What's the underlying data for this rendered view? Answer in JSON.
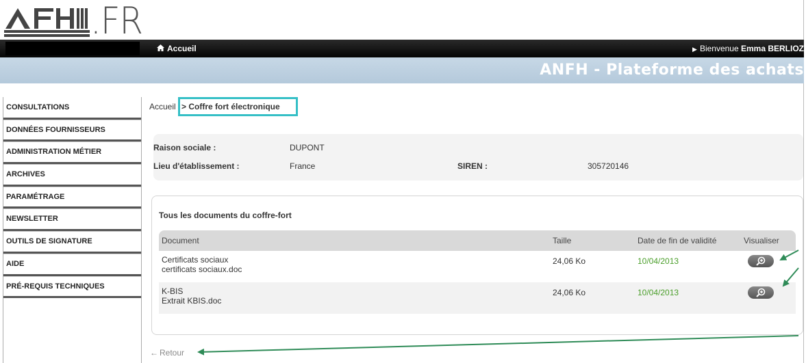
{
  "logo": {
    "brand_text": ".FR",
    "logo_name": "ANFH"
  },
  "topbar": {
    "home_label": "Accueil",
    "welcome_prefix": "Bienvenue ",
    "welcome_user": "Emma BERLIOZ"
  },
  "band": {
    "title": "ANFH - Plateforme des achats"
  },
  "sidebar": {
    "items": [
      {
        "label": "CONSULTATIONS"
      },
      {
        "label": "DONNÉES FOURNISSEURS"
      },
      {
        "label": "ADMINISTRATION MÉTIER"
      },
      {
        "label": "ARCHIVES"
      },
      {
        "label": "PARAMÉTRAGE"
      },
      {
        "label": "NEWSLETTER"
      },
      {
        "label": "OUTILS DE SIGNATURE"
      },
      {
        "label": "AIDE"
      },
      {
        "label": "PRÉ-REQUIS TECHNIQUES"
      }
    ]
  },
  "breadcrumb": {
    "root": "Accueil",
    "current": "> Coffre fort électronique"
  },
  "info": {
    "raison_label": "Raison sociale :",
    "raison_value": "DUPONT",
    "lieu_label": "Lieu d'établissement :",
    "lieu_value": "France",
    "siren_label": "SIREN :",
    "siren_value": "305720146"
  },
  "documents": {
    "heading": "Tous les documents du coffre-fort",
    "columns": [
      "Document",
      "Taille",
      "Date de fin de validité",
      "Visualiser"
    ],
    "rows": [
      {
        "name": "Certificats sociaux",
        "file": "certificats sociaux.doc",
        "size": "24,06 Ko",
        "date": "10/04/2013"
      },
      {
        "name": "K-BIS",
        "file": "Extrait KBIS.doc",
        "size": "24,06 Ko",
        "date": "10/04/2013"
      }
    ]
  },
  "back": {
    "label": "Retour"
  },
  "colors": {
    "accent_box": "#35bfc6",
    "date_green": "#4a9e2a",
    "annotation_arrow": "#2e8b57",
    "band": "#bdd0e0"
  },
  "icons": [
    "home-icon",
    "triangle-right-icon",
    "zoom-in-icon",
    "back-arrow-icon"
  ]
}
